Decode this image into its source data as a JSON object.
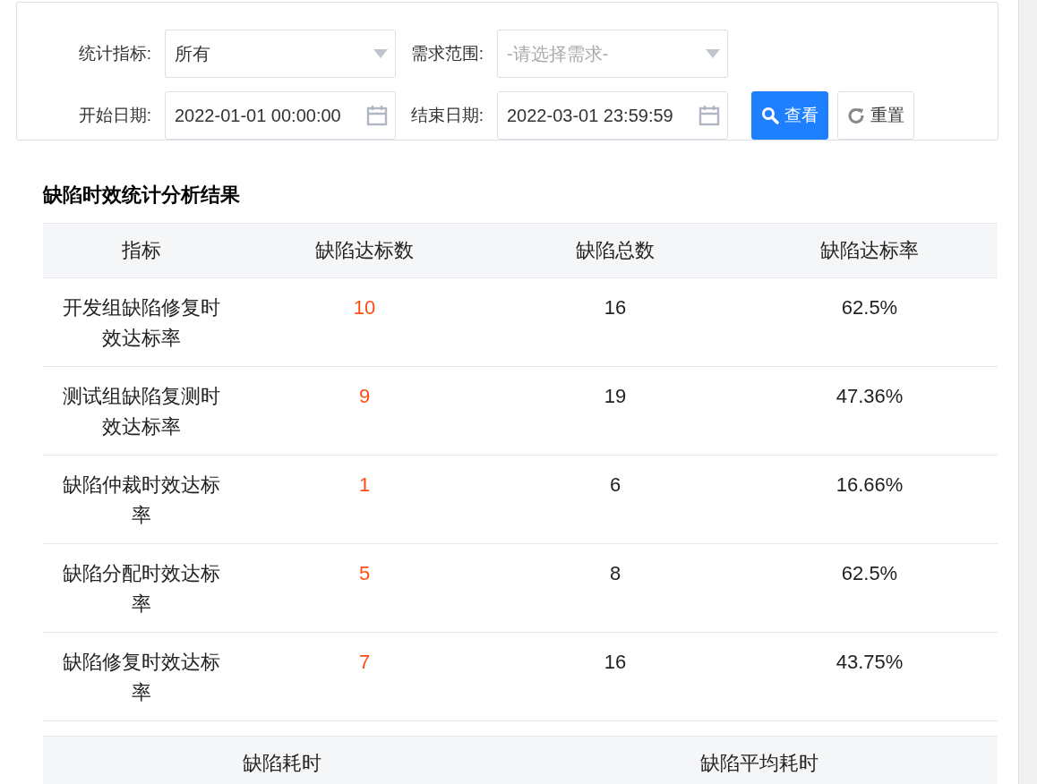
{
  "filters": [
    {
      "kind": "select",
      "label": "统计指标:",
      "value": "所有"
    },
    {
      "kind": "select",
      "label": "需求范围:",
      "placeholder": "-请选择需求-"
    },
    {
      "kind": "date",
      "label": "开始日期:",
      "value": "2022-01-01 00:00:00"
    },
    {
      "kind": "date",
      "label": "结束日期:",
      "value": "2022-03-01 23:59:59"
    }
  ],
  "buttons": [
    {
      "kind": "primary",
      "label": "查看"
    },
    {
      "kind": "default",
      "label": "重置"
    }
  ],
  "results": {
    "title": "缺陷时效统计分析结果",
    "columns": [
      "指标",
      "缺陷达标数",
      "缺陷总数",
      "缺陷达标率"
    ],
    "rows": [
      [
        "开发组缺陷修复时效达标率",
        "10",
        "16",
        "62.5%"
      ],
      [
        "测试组缺陷复测时效达标率",
        "9",
        "19",
        "47.36%"
      ],
      [
        "缺陷仲裁时效达标率",
        "1",
        "6",
        "16.66%"
      ],
      [
        "缺陷分配时效达标率",
        "5",
        "8",
        "62.5%"
      ],
      [
        "缺陷修复时效达标率",
        "7",
        "16",
        "43.75%"
      ]
    ]
  },
  "time_table": {
    "columns": [
      "缺陷耗时",
      "缺陷平均耗时"
    ]
  }
}
